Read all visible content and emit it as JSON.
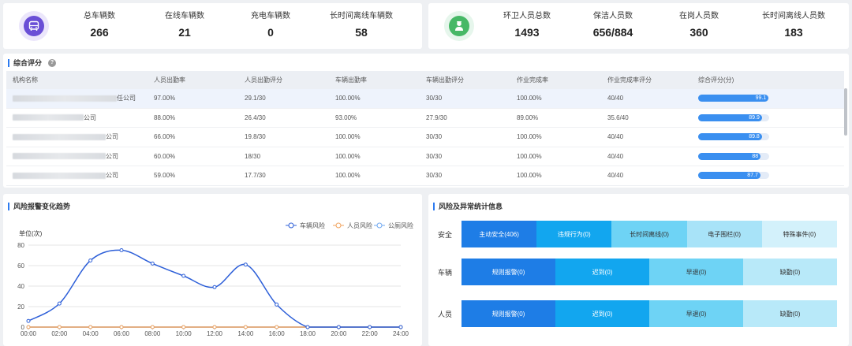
{
  "vehicle_stats": {
    "items": [
      {
        "label": "总车辆数",
        "value": "266"
      },
      {
        "label": "在线车辆数",
        "value": "21"
      },
      {
        "label": "充电车辆数",
        "value": "0"
      },
      {
        "label": "长时间离线车辆数",
        "value": "58"
      }
    ]
  },
  "staff_stats": {
    "items": [
      {
        "label": "环卫人员总数",
        "value": "1493"
      },
      {
        "label": "保洁人员数",
        "value": "656/884"
      },
      {
        "label": "在岗人员数",
        "value": "360"
      },
      {
        "label": "长时间离线人员数",
        "value": "183"
      }
    ]
  },
  "score_section": {
    "title": "综合评分",
    "headers": [
      "机构名称",
      "人员出勤率",
      "人员出勤评分",
      "车辆出勤率",
      "车辆出勤评分",
      "作业完成率",
      "作业完成率评分",
      "综合评分(分)"
    ],
    "rows": [
      {
        "org_suffix": "任公司",
        "c1": "97.00%",
        "c2": "29.1/30",
        "c3": "100.00%",
        "c4": "30/30",
        "c5": "100.00%",
        "c6": "40/40",
        "score": 99.1,
        "score_label": "99.1"
      },
      {
        "org_suffix": "公司",
        "c1": "88.00%",
        "c2": "26.4/30",
        "c3": "93.00%",
        "c4": "27.9/30",
        "c5": "89.00%",
        "c6": "35.6/40",
        "score": 89.9,
        "score_label": "89.9"
      },
      {
        "org_suffix": "公司",
        "c1": "66.00%",
        "c2": "19.8/30",
        "c3": "100.00%",
        "c4": "30/30",
        "c5": "100.00%",
        "c6": "40/40",
        "score": 89.8,
        "score_label": "89.8"
      },
      {
        "org_suffix": "公司",
        "c1": "60.00%",
        "c2": "18/30",
        "c3": "100.00%",
        "c4": "30/30",
        "c5": "100.00%",
        "c6": "40/40",
        "score": 88,
        "score_label": "88"
      },
      {
        "org_suffix": "公司",
        "c1": "59.00%",
        "c2": "17.7/30",
        "c3": "100.00%",
        "c4": "30/30",
        "c5": "100.00%",
        "c6": "40/40",
        "score": 87.7,
        "score_label": "87.7"
      }
    ]
  },
  "trend_section": {
    "title": "风险报警变化趋势"
  },
  "chart_data": {
    "type": "line",
    "ylabel": "单位(次)",
    "x": [
      "00:00",
      "02:00",
      "04:00",
      "06:00",
      "08:00",
      "10:00",
      "12:00",
      "14:00",
      "16:00",
      "18:00",
      "20:00",
      "22:00",
      "24:00"
    ],
    "ylim": [
      0,
      80
    ],
    "yticks": [
      0,
      20,
      40,
      60,
      80
    ],
    "series": [
      {
        "name": "车辆风险",
        "color": "#2d5fd8",
        "values": [
          6,
          23,
          65,
          75,
          62,
          50,
          39,
          61,
          22,
          0,
          0,
          0,
          0
        ]
      },
      {
        "name": "人员风险",
        "color": "#f0a35e",
        "values": [
          0,
          0,
          0,
          0,
          0,
          0,
          0,
          0,
          0,
          0,
          0,
          0,
          0
        ]
      },
      {
        "name": "公厕风险",
        "color": "#6fa8f0",
        "values": [
          0,
          0,
          0,
          0,
          0,
          0,
          0,
          0,
          0,
          0,
          0,
          0,
          0
        ]
      }
    ],
    "grid": true,
    "legend_position": "top-right"
  },
  "risk_section": {
    "title": "风险及异常统计信息",
    "rows": [
      {
        "label": "安全",
        "cells": [
          {
            "text": "主动安全(406)",
            "bg": "#1e7de6",
            "fg": "#ffffff"
          },
          {
            "text": "违规行为(0)",
            "bg": "#12a6ef",
            "fg": "#ffffff"
          },
          {
            "text": "长时间离线(0)",
            "bg": "#6ed3f5",
            "fg": "#333333"
          },
          {
            "text": "电子围栏(0)",
            "bg": "#a8e3f8",
            "fg": "#333333"
          },
          {
            "text": "特殊事件(0)",
            "bg": "#d3f1fb",
            "fg": "#333333"
          }
        ]
      },
      {
        "label": "车辆",
        "cells": [
          {
            "text": "规则报警(0)",
            "bg": "#1e7de6",
            "fg": "#ffffff"
          },
          {
            "text": "迟到(0)",
            "bg": "#12a6ef",
            "fg": "#ffffff"
          },
          {
            "text": "早退(0)",
            "bg": "#6ed3f5",
            "fg": "#333333"
          },
          {
            "text": "缺勤(0)",
            "bg": "#b8e9f9",
            "fg": "#333333"
          }
        ]
      },
      {
        "label": "人员",
        "cells": [
          {
            "text": "规则报警(0)",
            "bg": "#1e7de6",
            "fg": "#ffffff"
          },
          {
            "text": "迟到(0)",
            "bg": "#12a6ef",
            "fg": "#ffffff"
          },
          {
            "text": "早退(0)",
            "bg": "#6ed3f5",
            "fg": "#333333"
          },
          {
            "text": "缺勤(0)",
            "bg": "#b8e9f9",
            "fg": "#333333"
          }
        ]
      }
    ]
  },
  "icons": {
    "vehicle": "bus-icon",
    "staff": "worker-icon",
    "help": "question-icon"
  }
}
